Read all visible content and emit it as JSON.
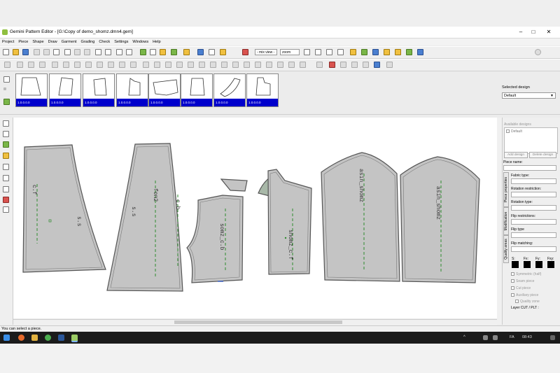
{
  "window": {
    "title": "Gemini Pattern Editor - [G:\\Copy of demo_shomz.dmn4.gem]",
    "minimize": "–",
    "maximize": "□",
    "close": "✕"
  },
  "menu": [
    "Project",
    "Piece",
    "Shape",
    "Draw",
    "Garment",
    "Grading",
    "Check",
    "Settings",
    "Windows",
    "Help"
  ],
  "toolbar": {
    "mix_view_label": "- mix view -",
    "zoom_label": "zoom"
  },
  "thumbnails": [
    {
      "label": "1.0.0.0.0"
    },
    {
      "label": "1.0.0.0.0"
    },
    {
      "label": "1.0.0.0.0"
    },
    {
      "label": "1.0.0.0.0"
    },
    {
      "label": "1.0.0.0.0"
    },
    {
      "label": "1.0.0.0.0"
    },
    {
      "label": "1.0.0.0.0"
    },
    {
      "label": "1.0.0.0.0"
    }
  ],
  "selected_design": {
    "label": "Selected design",
    "value": "Default"
  },
  "right_panel": {
    "available_designs": "Available designs",
    "default_item": "Default",
    "add_design": "Add design",
    "delete_design": "Delete design",
    "piece_name": "Piece name:",
    "fabric_type": "Fabric type:",
    "rotation_restriction": "Rotation restriction:",
    "rotation_type": "Rotation type:",
    "flip_restrictions": "Flip restrictions:",
    "flip_type": "Flip type",
    "flip_matching": "Flip matching:",
    "s": "S:",
    "fx": "Fx:",
    "fy": "Fy:",
    "fxy": "Fxy:",
    "symmetric": "Symmetric (half)",
    "seam_piece": "Seam piece",
    "cut_piece": "Cut piece",
    "auxiliary_piece": "Auxiliary piece",
    "quality_zone": "Quality zone",
    "layer": "Layer CUT / PLT :",
    "tabs": [
      "Piece properties",
      "Modification",
      "Quality areas"
    ]
  },
  "pieces": [
    {
      "text": "c.f"
    },
    {
      "text": "s.s"
    },
    {
      "text": "s.s"
    },
    {
      "text": "fon2"
    },
    {
      "text": "c.b"
    },
    {
      "text": "somz_c.b"
    },
    {
      "text": "shomz_c.f"
    },
    {
      "text": "asin_shomz"
    },
    {
      "text": "asin_shomz"
    }
  ],
  "status": "You can select a piece.",
  "taskbar": {
    "time": "08:43",
    "lang": "FA"
  }
}
